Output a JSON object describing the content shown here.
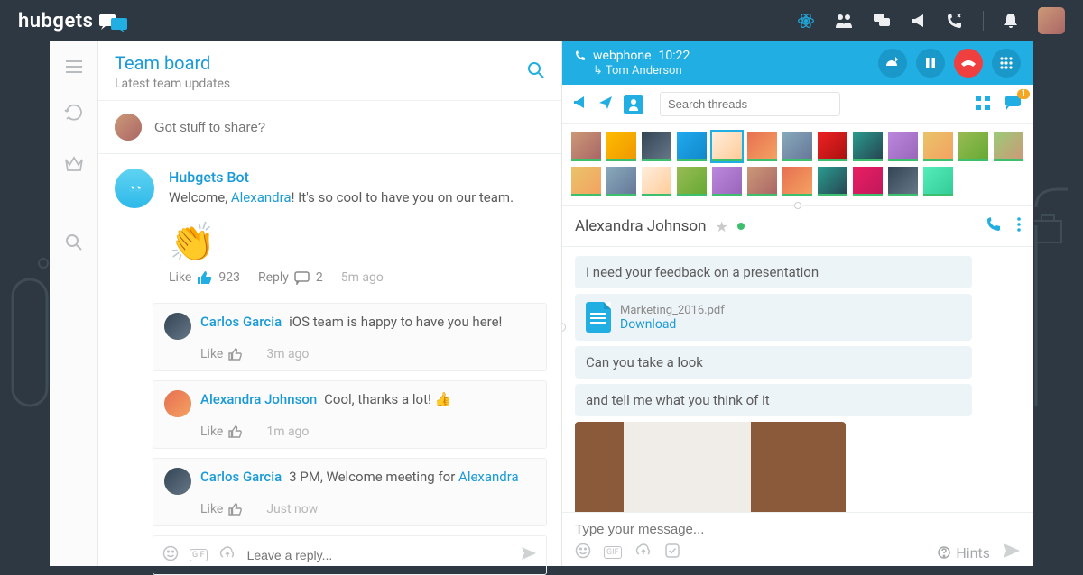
{
  "brand": "hubgets",
  "teamboard": {
    "title": "Team board",
    "subtitle": "Latest team updates",
    "compose_placeholder": "Got stuff to share?"
  },
  "post": {
    "author": "Hubgets Bot",
    "text_pre": "Welcome, ",
    "text_link": "Alexandra",
    "text_post": "! It's so cool to have you on our team.",
    "emoji": "👏",
    "like_label": "Like",
    "like_count": "923",
    "reply_label": "Reply",
    "reply_count": "2",
    "time": "5m ago"
  },
  "comments": [
    {
      "author": "Carlos Garcia",
      "text": "iOS team is happy to have you here!",
      "like": "Like",
      "time": "3m ago"
    },
    {
      "author": "Alexandra Johnson",
      "text": "Cool, thanks a lot! 👍",
      "like": "Like",
      "time": "1m ago"
    },
    {
      "author": "Carlos Garcia",
      "text_pre": "3 PM, Welcome meeting for ",
      "text_link": "Alexandra",
      "like": "Like",
      "time": "Just now"
    }
  ],
  "reply_placeholder": "Leave a reply...",
  "call": {
    "label": "webphone",
    "duration": "10:22",
    "to": "Tom Anderson"
  },
  "search_threads_placeholder": "Search threads",
  "chat_badge": "1",
  "chat": {
    "name": "Alexandra Johnson"
  },
  "messages": {
    "m1": "I need your feedback on a presentation",
    "file_name": "Marketing_2016.pdf",
    "download": "Download",
    "m2": "Can you take a look",
    "m3": "and tell me what you think of it"
  },
  "message_placeholder": "Type your message...",
  "hints_label": "Hints"
}
